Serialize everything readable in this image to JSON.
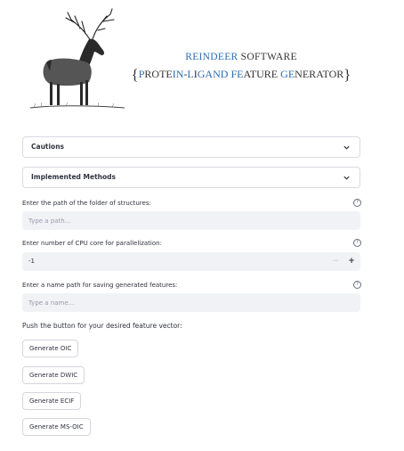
{
  "header": {
    "logo_icon": "reindeer-illustration",
    "title_line1": {
      "r": "R",
      "eindeer": "EINDEER",
      "software": " SOFTWARE"
    },
    "title_line2": {
      "open": "{",
      "p": "P",
      "rote": "ROTE",
      "in": "IN",
      "dash": "-",
      "l": "L",
      "i": "I",
      "gand": "GAND ",
      "f": "F",
      "e": "E",
      "ature": "ATURE ",
      "g": "G",
      "e2": "E",
      "nerator": "NERATOR",
      "close": "}"
    },
    "accent_color": "#2b6cb0"
  },
  "expanders": [
    {
      "label": "Cautions",
      "icon": "chevron-down-icon"
    },
    {
      "label": "Implemented Methods",
      "icon": "chevron-down-icon"
    }
  ],
  "structures_path": {
    "label": "Enter the path of the folder of structures:",
    "placeholder": "Type a path...",
    "value": "",
    "help_icon": "?"
  },
  "cpu_cores": {
    "label": "Enter number of CPU core for parallelization:",
    "value": "-1",
    "minus": "−",
    "plus": "+",
    "help_icon": "?"
  },
  "output_name": {
    "label": "Enter a name path for saving generated features:",
    "placeholder": "Type a name...",
    "value": "",
    "help_icon": "?"
  },
  "buttons_section": {
    "prompt": "Push the button for your desired feature vector:",
    "buttons": [
      "Generate OIC",
      "Generate DWIC",
      "Generate ECIF",
      "Generate MS-OIC"
    ]
  }
}
